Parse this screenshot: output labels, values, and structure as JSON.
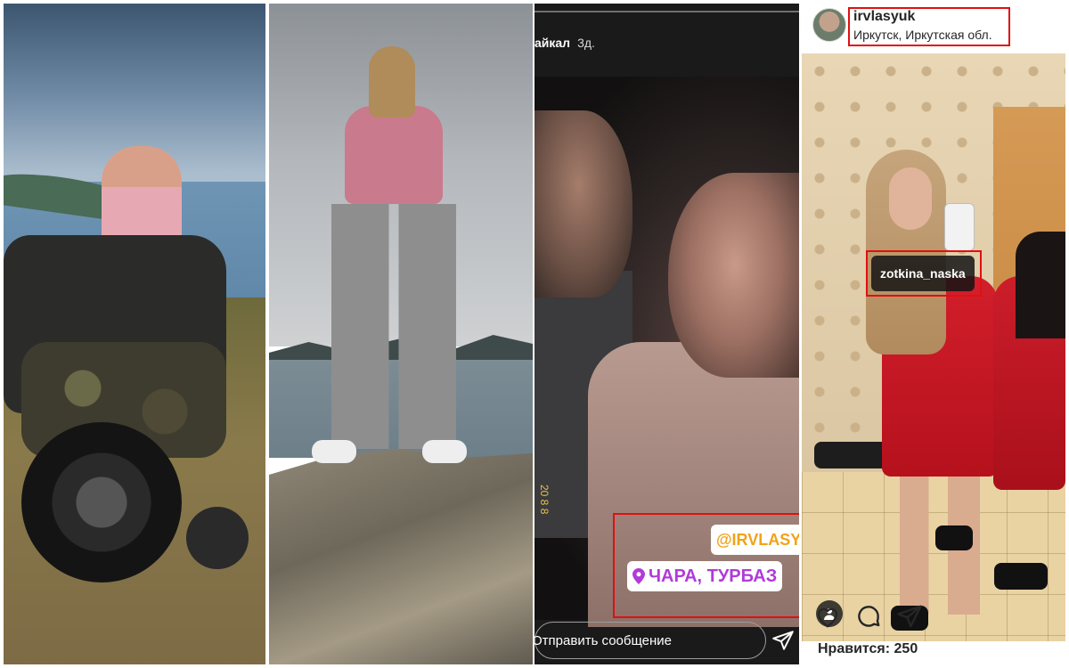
{
  "story": {
    "username": "айкал",
    "time_ago": "3д.",
    "date_sticker": "20 8 8",
    "mention_sticker": "@IRVLASYU",
    "location_sticker": "ЧАРА, ТУРБАЗ",
    "reply_placeholder": "Отправить сообщение",
    "icons": {
      "location": "location-pin-icon",
      "send": "send-icon"
    }
  },
  "post": {
    "username": "irvlasyuk",
    "location": "Иркутск, Иркутская обл.",
    "user_tag": "zotkina_naska",
    "likes": "Нравится: 250",
    "icons": {
      "like": "heart-icon",
      "comment": "comment-icon",
      "share": "send-icon",
      "tagged_user": "person-icon"
    }
  },
  "colors": {
    "highlight_box": "#e01010",
    "mention_text": "#f0a31a",
    "location_text": "#b13ad8",
    "ig_text": "#262626"
  }
}
